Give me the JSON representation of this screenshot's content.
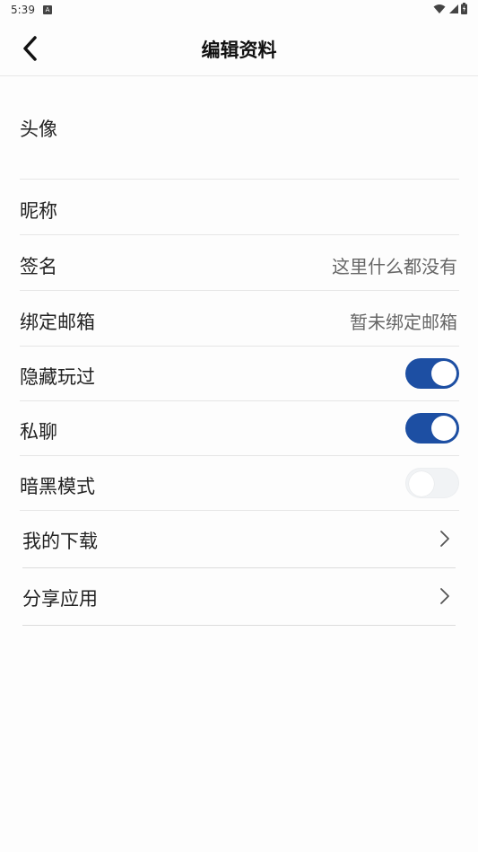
{
  "status_bar": {
    "time": "5:39",
    "notification_badge": "A",
    "icons": [
      "wifi-icon",
      "cellular-signal-icon",
      "battery-icon"
    ]
  },
  "header": {
    "title": "编辑资料",
    "back_icon": "chevron-left-icon"
  },
  "profile": {
    "avatar_label": "头像",
    "nickname_label": "昵称",
    "signature_label": "签名",
    "signature_value": "这里什么都没有",
    "email_label": "绑定邮箱",
    "email_value": "暂未绑定邮箱"
  },
  "settings": {
    "hide_played_label": "隐藏玩过",
    "hide_played_on": true,
    "private_chat_label": "私聊",
    "private_chat_on": true,
    "dark_mode_label": "暗黑模式",
    "dark_mode_on": false
  },
  "links": {
    "downloads_label": "我的下载",
    "share_label": "分享应用"
  },
  "colors": {
    "accent": "#1d4fa3",
    "toggle_off": "#f1f3f5",
    "divider": "#e6e6e6"
  }
}
